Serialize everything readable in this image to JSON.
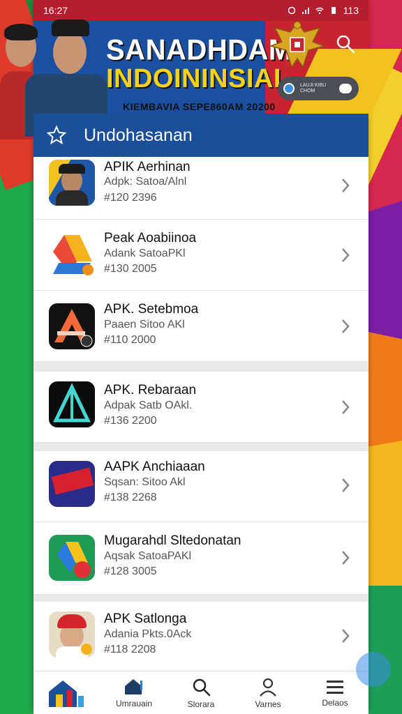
{
  "status": {
    "time": "16:27",
    "battery": "113"
  },
  "banner": {
    "title_line1": "SANADHDAM",
    "title_line2": "INDOININSIAI",
    "subtitle": "KIEMBAVIA SEPE860AM 20200",
    "promo_text": "LAUJI KIBU CHOM",
    "colors": {
      "blue": "#1b4fa0",
      "red": "#c8242f",
      "yellow": "#f4c21f"
    }
  },
  "section": {
    "title": "Undohasanan",
    "icon": "star-outline-icon"
  },
  "apps": [
    {
      "name": "APIK Aerhinan",
      "desc": "Adpk: Satoa/Alnl",
      "num": "#120 2396",
      "icon": "person-cap-icon"
    },
    {
      "name": "Peak Aoabiinoa",
      "desc": "Adank SatoaPKl",
      "num": "#130 2005",
      "icon": "drive-orange-icon"
    },
    {
      "name": "APK. Setebmoa",
      "desc": "Paaen Sitoo AKl",
      "num": "#110 2000",
      "icon": "a-logo-icon"
    },
    {
      "name": "APK. Rebaraan",
      "desc": "Adpak Satb OAkl.",
      "num": "#136 2200",
      "icon": "teal-triangle-icon"
    },
    {
      "name": "AAPK Anchiaaan",
      "desc": "Sqsan: Sitoo Akl",
      "num": "#138 2268",
      "icon": "red-banner-icon"
    },
    {
      "name": "Mugarahdl Sltedonatan",
      "desc": "Aqsak SatoaPAKl",
      "num": "#128 3005",
      "icon": "drive-green-icon"
    },
    {
      "name": "APK Satlonga",
      "desc": "Adania Pkts.0Ack",
      "num": "#118 2208",
      "icon": "woman-red-hat-icon"
    }
  ],
  "nav": [
    {
      "label": "Umrauain",
      "icon": "home-icon"
    },
    {
      "label": "Slorara",
      "icon": "search-icon"
    },
    {
      "label": "Varnes",
      "icon": "user-icon"
    },
    {
      "label": "Delaos",
      "icon": "menu-icon"
    }
  ]
}
